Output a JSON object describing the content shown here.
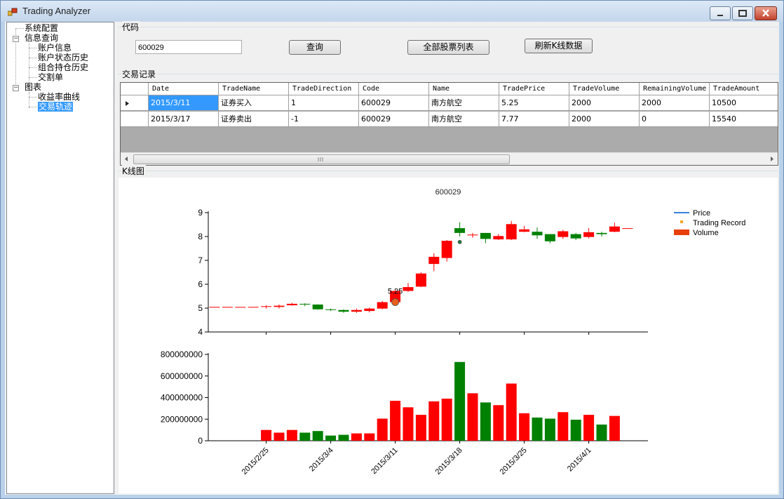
{
  "window": {
    "title": "Trading Analyzer"
  },
  "tree": [
    {
      "label": "系统配置"
    },
    {
      "label": "信息查询"
    },
    {
      "label": "账户信息"
    },
    {
      "label": "账户状态历史"
    },
    {
      "label": "组合持仓历史"
    },
    {
      "label": "交割单"
    },
    {
      "label": "图表"
    },
    {
      "label": "收益率曲线"
    },
    {
      "label": "交易轨迹"
    }
  ],
  "code_group": {
    "label": "代码",
    "value": "600029"
  },
  "buttons": {
    "query": "查询",
    "all_stocks": "全部股票列表",
    "refresh_kline": "刷新K线数据"
  },
  "trade_group": {
    "label": "交易记录"
  },
  "table": {
    "columns": [
      "Date",
      "TradeName",
      "TradeDirection",
      "Code",
      "Name",
      "TradePrice",
      "TradeVolume",
      "RemainingVolume",
      "TradeAmount"
    ],
    "rows": [
      [
        "2015/3/11",
        "证券买入",
        "1",
        "600029",
        "南方航空",
        "5.25",
        "2000",
        "2000",
        "10500"
      ],
      [
        "2015/3/17",
        "证券卖出",
        "-1",
        "600029",
        "南方航空",
        "7.77",
        "2000",
        "0",
        "15540"
      ]
    ]
  },
  "kline_group": {
    "label": "K线图"
  },
  "colors": {
    "up": "#ff0000",
    "down": "#008000",
    "price": "#3a7fdd",
    "trade": "#f5a623",
    "volume": "#e8400c"
  },
  "chart_data": {
    "type": "candlestick",
    "title": "600029",
    "legend": {
      "position": "top-right",
      "items": [
        "Price",
        "Trading Record",
        "Volume"
      ]
    },
    "price_axis": {
      "ylim": [
        4,
        9
      ],
      "ticks": [
        4,
        5,
        6,
        7,
        8,
        9
      ]
    },
    "volume_axis": {
      "ylim": [
        0,
        800000000
      ],
      "ticks": [
        0,
        200000000,
        400000000,
        600000000,
        800000000
      ]
    },
    "x_tick_labels": [
      "2015/2/25",
      "2015/3/4",
      "2015/3/11",
      "2015/3/18",
      "2015/3/25",
      "2015/4/1"
    ],
    "x_tick_index": [
      4,
      9,
      14,
      19,
      24,
      29
    ],
    "candles": [
      {
        "o": 5.05,
        "c": 5.05,
        "h": 5.05,
        "l": 5.05,
        "v": 0
      },
      {
        "o": 5.05,
        "c": 5.05,
        "h": 5.05,
        "l": 5.05,
        "v": 0
      },
      {
        "o": 5.05,
        "c": 5.05,
        "h": 5.05,
        "l": 5.05,
        "v": 0
      },
      {
        "o": 5.05,
        "c": 5.05,
        "h": 5.05,
        "l": 5.05,
        "v": 0
      },
      {
        "o": 5.05,
        "c": 5.08,
        "h": 5.12,
        "l": 4.98,
        "v": 100000000
      },
      {
        "o": 5.05,
        "c": 5.1,
        "h": 5.15,
        "l": 4.98,
        "v": 75000000
      },
      {
        "o": 5.12,
        "c": 5.18,
        "h": 5.22,
        "l": 5.1,
        "v": 100000000
      },
      {
        "o": 5.18,
        "c": 5.15,
        "h": 5.2,
        "l": 5.08,
        "v": 75000000
      },
      {
        "o": 5.15,
        "c": 4.95,
        "h": 5.15,
        "l": 4.93,
        "v": 90000000
      },
      {
        "o": 4.95,
        "c": 4.92,
        "h": 4.98,
        "l": 4.88,
        "v": 48000000
      },
      {
        "o": 4.92,
        "c": 4.85,
        "h": 4.95,
        "l": 4.8,
        "v": 55000000
      },
      {
        "o": 4.85,
        "c": 4.92,
        "h": 4.98,
        "l": 4.8,
        "v": 68000000
      },
      {
        "o": 4.88,
        "c": 4.98,
        "h": 5.02,
        "l": 4.82,
        "v": 68000000
      },
      {
        "o": 4.98,
        "c": 5.25,
        "h": 5.3,
        "l": 4.95,
        "v": 205000000
      },
      {
        "o": 5.25,
        "c": 5.72,
        "h": 5.78,
        "l": 5.2,
        "v": 370000000
      },
      {
        "o": 5.72,
        "c": 5.88,
        "h": 6.05,
        "l": 5.68,
        "v": 310000000
      },
      {
        "o": 5.9,
        "c": 6.45,
        "h": 6.5,
        "l": 5.88,
        "v": 240000000
      },
      {
        "o": 6.85,
        "c": 7.15,
        "h": 7.3,
        "l": 6.55,
        "v": 365000000
      },
      {
        "o": 7.1,
        "c": 7.82,
        "h": 7.85,
        "l": 6.95,
        "v": 390000000
      },
      {
        "o": 8.35,
        "c": 8.15,
        "h": 8.6,
        "l": 8.0,
        "v": 730000000
      },
      {
        "o": 8.05,
        "c": 8.08,
        "h": 8.15,
        "l": 7.95,
        "v": 440000000
      },
      {
        "o": 8.15,
        "c": 7.9,
        "h": 8.15,
        "l": 7.72,
        "v": 355000000
      },
      {
        "o": 7.88,
        "c": 8.02,
        "h": 8.1,
        "l": 7.85,
        "v": 330000000
      },
      {
        "o": 7.88,
        "c": 8.52,
        "h": 8.65,
        "l": 7.85,
        "v": 530000000
      },
      {
        "o": 8.2,
        "c": 8.3,
        "h": 8.45,
        "l": 8.18,
        "v": 255000000
      },
      {
        "o": 8.2,
        "c": 8.05,
        "h": 8.38,
        "l": 7.9,
        "v": 215000000
      },
      {
        "o": 8.1,
        "c": 7.8,
        "h": 8.1,
        "l": 7.72,
        "v": 205000000
      },
      {
        "o": 7.98,
        "c": 8.22,
        "h": 8.28,
        "l": 7.9,
        "v": 265000000
      },
      {
        "o": 8.1,
        "c": 7.92,
        "h": 8.15,
        "l": 7.85,
        "v": 195000000
      },
      {
        "o": 7.98,
        "c": 8.18,
        "h": 8.35,
        "l": 7.92,
        "v": 240000000
      },
      {
        "o": 8.15,
        "c": 8.1,
        "h": 8.2,
        "l": 8.0,
        "v": 150000000
      },
      {
        "o": 8.2,
        "c": 8.42,
        "h": 8.58,
        "l": 8.18,
        "v": 230000000
      },
      {
        "o": 8.35,
        "c": 8.35,
        "h": 8.35,
        "l": 8.35,
        "v": 0
      }
    ],
    "trades": [
      {
        "index": 14,
        "price": 5.25,
        "label": "5.25"
      },
      {
        "index": 19,
        "price": 7.77,
        "label": ""
      }
    ]
  }
}
